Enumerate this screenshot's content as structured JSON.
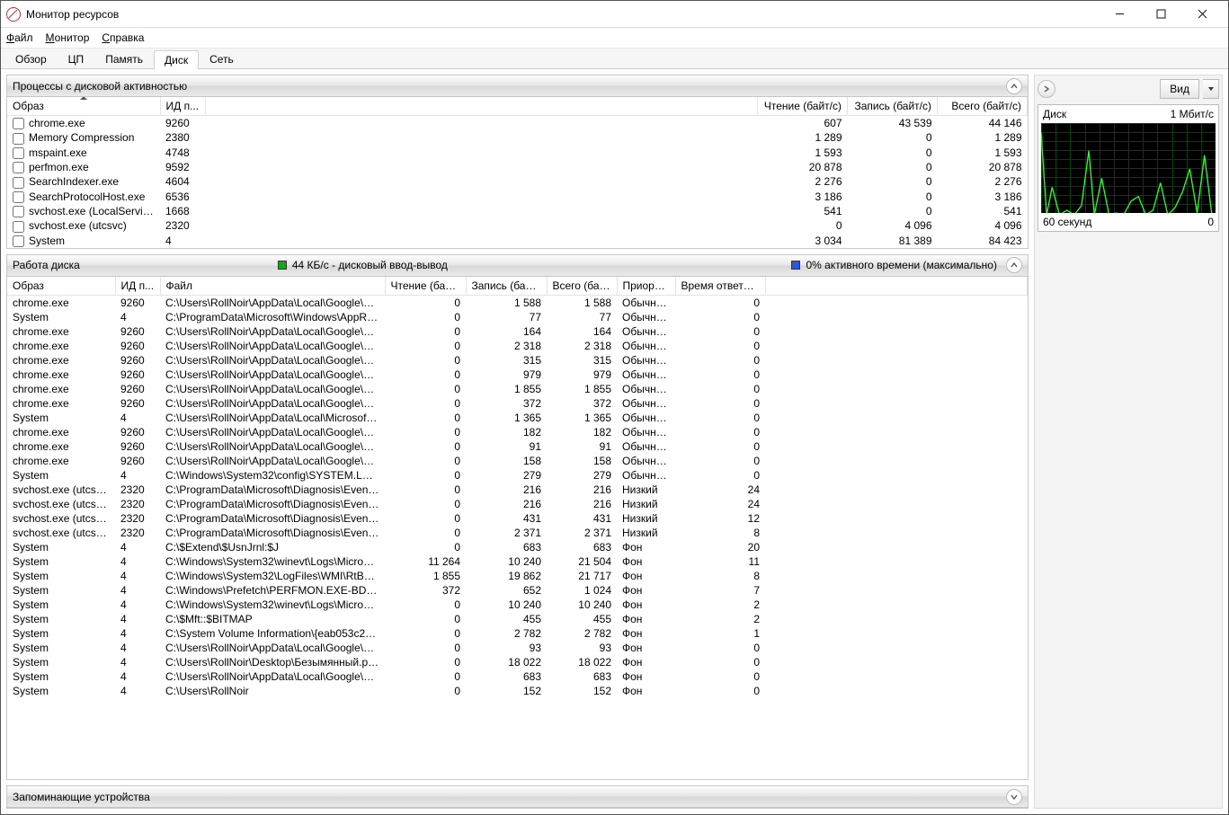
{
  "window_title": "Монитор ресурсов",
  "menu": {
    "file": "Файл",
    "monitor": "Монитор",
    "help": "Справка"
  },
  "tabs": [
    "Обзор",
    "ЦП",
    "Память",
    "Диск",
    "Сеть"
  ],
  "active_tab": 3,
  "panel1": {
    "title": "Процессы с дисковой активностью",
    "columns": [
      "Образ",
      "ИД п...",
      "Чтение (байт/с)",
      "Запись (байт/с)",
      "Всего (байт/с)"
    ],
    "rows": [
      {
        "img": "chrome.exe",
        "pid": "9260",
        "r": "607",
        "w": "43 539",
        "t": "44 146"
      },
      {
        "img": "Memory Compression",
        "pid": "2380",
        "r": "1 289",
        "w": "0",
        "t": "1 289"
      },
      {
        "img": "mspaint.exe",
        "pid": "4748",
        "r": "1 593",
        "w": "0",
        "t": "1 593"
      },
      {
        "img": "perfmon.exe",
        "pid": "9592",
        "r": "20 878",
        "w": "0",
        "t": "20 878"
      },
      {
        "img": "SearchIndexer.exe",
        "pid": "4604",
        "r": "2 276",
        "w": "0",
        "t": "2 276"
      },
      {
        "img": "SearchProtocolHost.exe",
        "pid": "6536",
        "r": "3 186",
        "w": "0",
        "t": "3 186"
      },
      {
        "img": "svchost.exe (LocalServiceNo...",
        "pid": "1668",
        "r": "541",
        "w": "0",
        "t": "541"
      },
      {
        "img": "svchost.exe (utcsvc)",
        "pid": "2320",
        "r": "0",
        "w": "4 096",
        "t": "4 096"
      },
      {
        "img": "System",
        "pid": "4",
        "r": "3 034",
        "w": "81 389",
        "t": "84 423"
      }
    ]
  },
  "panel2": {
    "title": "Работа диска",
    "metric1": "44 КБ/с - дисковый ввод-вывод",
    "metric2": "0% активного времени (максимально)",
    "columns": [
      "Образ",
      "ИД п...",
      "Файл",
      "Чтение (байт/с)",
      "Запись (байт/с)",
      "Всего (бай...",
      "Приори...",
      "Время ответа (..."
    ],
    "rows": [
      {
        "img": "chrome.exe",
        "pid": "9260",
        "file": "C:\\Users\\RollNoir\\AppData\\Local\\Google\\Chr...",
        "r": "0",
        "w": "1 588",
        "t": "1 588",
        "pri": "Обычный",
        "rt": "0"
      },
      {
        "img": "System",
        "pid": "4",
        "file": "C:\\ProgramData\\Microsoft\\Windows\\AppRep...",
        "r": "0",
        "w": "77",
        "t": "77",
        "pri": "Обычный",
        "rt": "0"
      },
      {
        "img": "chrome.exe",
        "pid": "9260",
        "file": "C:\\Users\\RollNoir\\AppData\\Local\\Google\\Chr...",
        "r": "0",
        "w": "164",
        "t": "164",
        "pri": "Обычный",
        "rt": "0"
      },
      {
        "img": "chrome.exe",
        "pid": "9260",
        "file": "C:\\Users\\RollNoir\\AppData\\Local\\Google\\Chr...",
        "r": "0",
        "w": "2 318",
        "t": "2 318",
        "pri": "Обычный",
        "rt": "0"
      },
      {
        "img": "chrome.exe",
        "pid": "9260",
        "file": "C:\\Users\\RollNoir\\AppData\\Local\\Google\\Chr...",
        "r": "0",
        "w": "315",
        "t": "315",
        "pri": "Обычный",
        "rt": "0"
      },
      {
        "img": "chrome.exe",
        "pid": "9260",
        "file": "C:\\Users\\RollNoir\\AppData\\Local\\Google\\Chr...",
        "r": "0",
        "w": "979",
        "t": "979",
        "pri": "Обычный",
        "rt": "0"
      },
      {
        "img": "chrome.exe",
        "pid": "9260",
        "file": "C:\\Users\\RollNoir\\AppData\\Local\\Google\\Chr...",
        "r": "0",
        "w": "1 855",
        "t": "1 855",
        "pri": "Обычный",
        "rt": "0"
      },
      {
        "img": "chrome.exe",
        "pid": "9260",
        "file": "C:\\Users\\RollNoir\\AppData\\Local\\Google\\Chr...",
        "r": "0",
        "w": "372",
        "t": "372",
        "pri": "Обычный",
        "rt": "0"
      },
      {
        "img": "System",
        "pid": "4",
        "file": "C:\\Users\\RollNoir\\AppData\\Local\\Microsoft\\...",
        "r": "0",
        "w": "1 365",
        "t": "1 365",
        "pri": "Обычный",
        "rt": "0"
      },
      {
        "img": "chrome.exe",
        "pid": "9260",
        "file": "C:\\Users\\RollNoir\\AppData\\Local\\Google\\Chr...",
        "r": "0",
        "w": "182",
        "t": "182",
        "pri": "Обычный",
        "rt": "0"
      },
      {
        "img": "chrome.exe",
        "pid": "9260",
        "file": "C:\\Users\\RollNoir\\AppData\\Local\\Google\\Chr...",
        "r": "0",
        "w": "91",
        "t": "91",
        "pri": "Обычный",
        "rt": "0"
      },
      {
        "img": "chrome.exe",
        "pid": "9260",
        "file": "C:\\Users\\RollNoir\\AppData\\Local\\Google\\Chr...",
        "r": "0",
        "w": "158",
        "t": "158",
        "pri": "Обычный",
        "rt": "0"
      },
      {
        "img": "System",
        "pid": "4",
        "file": "C:\\Windows\\System32\\config\\SYSTEM.LOG2",
        "r": "0",
        "w": "279",
        "t": "279",
        "pri": "Обычный",
        "rt": "0"
      },
      {
        "img": "svchost.exe (utcsvc)",
        "pid": "2320",
        "file": "C:\\ProgramData\\Microsoft\\Diagnosis\\Events_...",
        "r": "0",
        "w": "216",
        "t": "216",
        "pri": "Низкий",
        "rt": "24"
      },
      {
        "img": "svchost.exe (utcsvc)",
        "pid": "2320",
        "file": "C:\\ProgramData\\Microsoft\\Diagnosis\\Events_...",
        "r": "0",
        "w": "216",
        "t": "216",
        "pri": "Низкий",
        "rt": "24"
      },
      {
        "img": "svchost.exe (utcsvc)",
        "pid": "2320",
        "file": "C:\\ProgramData\\Microsoft\\Diagnosis\\Events_...",
        "r": "0",
        "w": "431",
        "t": "431",
        "pri": "Низкий",
        "rt": "12"
      },
      {
        "img": "svchost.exe (utcsvc)",
        "pid": "2320",
        "file": "C:\\ProgramData\\Microsoft\\Diagnosis\\Events_...",
        "r": "0",
        "w": "2 371",
        "t": "2 371",
        "pri": "Низкий",
        "rt": "8"
      },
      {
        "img": "System",
        "pid": "4",
        "file": "C:\\$Extend\\$UsnJrnl:$J",
        "r": "0",
        "w": "683",
        "t": "683",
        "pri": "Фон",
        "rt": "20"
      },
      {
        "img": "System",
        "pid": "4",
        "file": "C:\\Windows\\System32\\winevt\\Logs\\Microsof...",
        "r": "11 264",
        "w": "10 240",
        "t": "21 504",
        "pri": "Фон",
        "rt": "11"
      },
      {
        "img": "System",
        "pid": "4",
        "file": "C:\\Windows\\System32\\LogFiles\\WMI\\RtBack...",
        "r": "1 855",
        "w": "19 862",
        "t": "21 717",
        "pri": "Фон",
        "rt": "8"
      },
      {
        "img": "System",
        "pid": "4",
        "file": "C:\\Windows\\Prefetch\\PERFMON.EXE-BD9AD9...",
        "r": "372",
        "w": "652",
        "t": "1 024",
        "pri": "Фон",
        "rt": "7"
      },
      {
        "img": "System",
        "pid": "4",
        "file": "C:\\Windows\\System32\\winevt\\Logs\\Microsof...",
        "r": "0",
        "w": "10 240",
        "t": "10 240",
        "pri": "Фон",
        "rt": "2"
      },
      {
        "img": "System",
        "pid": "4",
        "file": "C:\\$Mft::$BITMAP",
        "r": "0",
        "w": "455",
        "t": "455",
        "pri": "Фон",
        "rt": "2"
      },
      {
        "img": "System",
        "pid": "4",
        "file": "C:\\System Volume Information\\{eab053c2-c88...",
        "r": "0",
        "w": "2 782",
        "t": "2 782",
        "pri": "Фон",
        "rt": "1"
      },
      {
        "img": "System",
        "pid": "4",
        "file": "C:\\Users\\RollNoir\\AppData\\Local\\Google\\Chr...",
        "r": "0",
        "w": "93",
        "t": "93",
        "pri": "Фон",
        "rt": "0"
      },
      {
        "img": "System",
        "pid": "4",
        "file": "C:\\Users\\RollNoir\\Desktop\\Безымянный.png",
        "r": "0",
        "w": "18 022",
        "t": "18 022",
        "pri": "Фон",
        "rt": "0"
      },
      {
        "img": "System",
        "pid": "4",
        "file": "C:\\Users\\RollNoir\\AppData\\Local\\Google\\Chr...",
        "r": "0",
        "w": "683",
        "t": "683",
        "pri": "Фон",
        "rt": "0"
      },
      {
        "img": "System",
        "pid": "4",
        "file": "C:\\Users\\RollNoir",
        "r": "0",
        "w": "152",
        "t": "152",
        "pri": "Фон",
        "rt": "0"
      }
    ]
  },
  "panel3": {
    "title": "Запоминающие устройства"
  },
  "sidebar": {
    "view_label": "Вид",
    "chart_title": "Диск",
    "chart_unit": "1 Мбит/с",
    "chart_footer_left": "60 секунд",
    "chart_footer_right": "0"
  }
}
